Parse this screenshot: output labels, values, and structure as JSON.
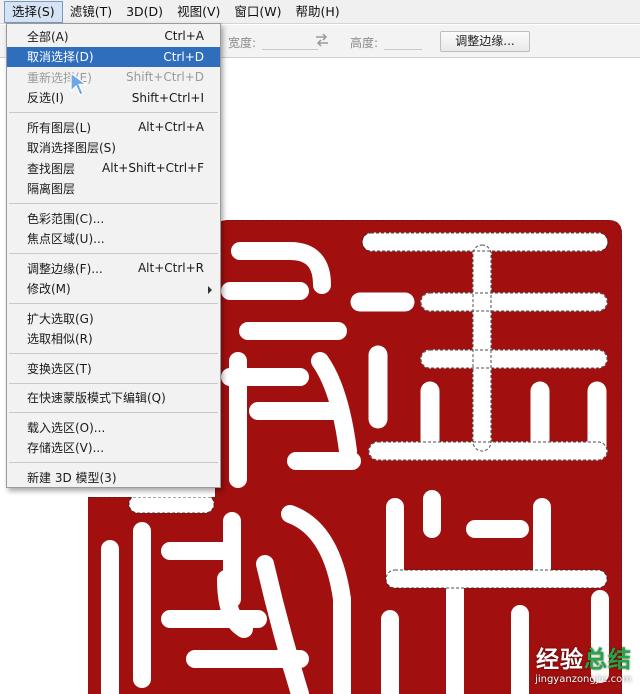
{
  "menubar": {
    "items": [
      {
        "label": "选择(S)"
      },
      {
        "label": "滤镜(T)"
      },
      {
        "label": "3D(D)"
      },
      {
        "label": "视图(V)"
      },
      {
        "label": "窗口(W)"
      },
      {
        "label": "帮助(H)"
      }
    ]
  },
  "options": {
    "width_label": "宽度:",
    "height_label": "高度:",
    "refine_button": "调整边缘..."
  },
  "dropdown": {
    "items": [
      {
        "label": "全部(A)",
        "shortcut": "Ctrl+A"
      },
      {
        "label": "取消选择(D)",
        "shortcut": "Ctrl+D"
      },
      {
        "label": "重新选择(E)",
        "shortcut": "Shift+Ctrl+D"
      },
      {
        "label": "反选(I)",
        "shortcut": "Shift+Ctrl+I"
      },
      {
        "label": "所有图层(L)",
        "shortcut": "Alt+Ctrl+A"
      },
      {
        "label": "取消选择图层(S)",
        "shortcut": ""
      },
      {
        "label": "查找图层",
        "shortcut": "Alt+Shift+Ctrl+F"
      },
      {
        "label": "隔离图层",
        "shortcut": ""
      },
      {
        "label": "色彩范围(C)...",
        "shortcut": ""
      },
      {
        "label": "焦点区域(U)...",
        "shortcut": ""
      },
      {
        "label": "调整边缘(F)...",
        "shortcut": "Alt+Ctrl+R"
      },
      {
        "label": "修改(M)",
        "shortcut": ""
      },
      {
        "label": "扩大选取(G)",
        "shortcut": ""
      },
      {
        "label": "选取相似(R)",
        "shortcut": ""
      },
      {
        "label": "变换选区(T)",
        "shortcut": ""
      },
      {
        "label": "在快速蒙版模式下编辑(Q)",
        "shortcut": ""
      },
      {
        "label": "载入选区(O)...",
        "shortcut": ""
      },
      {
        "label": "存储选区(V)...",
        "shortcut": ""
      },
      {
        "label": "新建 3D 模型(3)",
        "shortcut": ""
      }
    ]
  },
  "watermark": {
    "brand_a": "经验",
    "brand_b": "总结",
    "url": "jingyanzongjie.com"
  },
  "colors": {
    "seal_red": "#a20f0f",
    "highlight_blue": "#2e6ebd",
    "active_menu_bg": "#d5e3f5"
  }
}
